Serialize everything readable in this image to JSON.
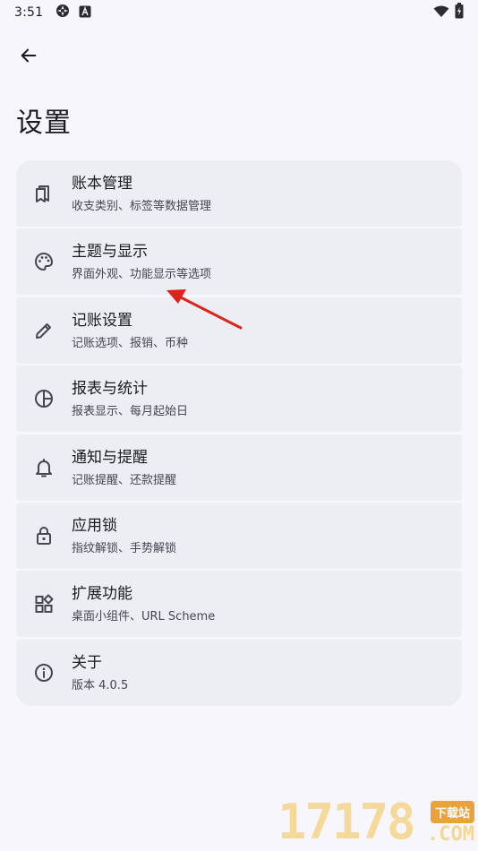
{
  "status_bar": {
    "time": "3:51"
  },
  "header": {
    "title": "设置"
  },
  "settings": [
    {
      "id": "ledger",
      "icon": "book-icon",
      "title": "账本管理",
      "subtitle": "收支类别、标签等数据管理"
    },
    {
      "id": "theme",
      "icon": "palette-icon",
      "title": "主题与显示",
      "subtitle": "界面外观、功能显示等选项"
    },
    {
      "id": "bookkeeping",
      "icon": "pencil-icon",
      "title": "记账设置",
      "subtitle": "记账选项、报销、币种"
    },
    {
      "id": "reports",
      "icon": "pie-chart-icon",
      "title": "报表与统计",
      "subtitle": "报表显示、每月起始日"
    },
    {
      "id": "notifications",
      "icon": "bell-icon",
      "title": "通知与提醒",
      "subtitle": "记账提醒、还款提醒"
    },
    {
      "id": "app-lock",
      "icon": "lock-icon",
      "title": "应用锁",
      "subtitle": "指纹解锁、手势解锁"
    },
    {
      "id": "extensions",
      "icon": "widgets-icon",
      "title": "扩展功能",
      "subtitle": "桌面小组件、URL Scheme"
    },
    {
      "id": "about",
      "icon": "info-icon",
      "title": "关于",
      "subtitle": "版本 4.0.5"
    }
  ],
  "watermark": {
    "digits": "17178",
    "badge": "下载站",
    "suffix": ".COM"
  },
  "colors": {
    "background": "#f6f6fb",
    "card": "#eceef4",
    "annotation_arrow": "#d9261c"
  }
}
